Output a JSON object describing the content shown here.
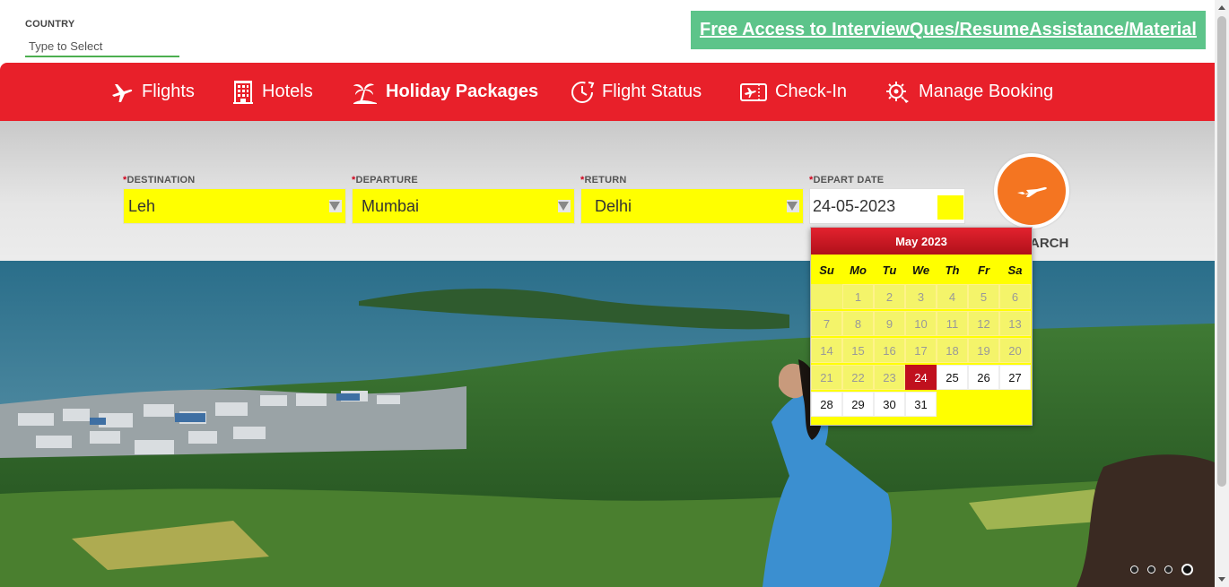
{
  "country": {
    "label": "COUNTRY",
    "placeholder": "Type to Select"
  },
  "promo": {
    "text": "Free Access to InterviewQues/ResumeAssistance/Material"
  },
  "nav": {
    "flights": "Flights",
    "hotels": "Hotels",
    "holiday": "Holiday Packages",
    "status": "Flight Status",
    "checkin": "Check-In",
    "manage": "Manage Booking"
  },
  "form": {
    "destination_label": "DESTINATION",
    "destination_value": "Leh",
    "departure_label": "DEPARTURE",
    "departure_value": "Mumbai",
    "return_label": "RETURN",
    "return_value": "Delhi",
    "depart_date_label": "DEPART DATE",
    "depart_date_value": "24-05-2023",
    "required_mark": "*"
  },
  "search": {
    "label": "ARCH"
  },
  "calendar": {
    "title": "May 2023",
    "days_of_week": [
      "Su",
      "Mo",
      "Tu",
      "We",
      "Th",
      "Fr",
      "Sa"
    ],
    "weeks": [
      [
        null,
        "1",
        "2",
        "3",
        "4",
        "5",
        "6"
      ],
      [
        "7",
        "8",
        "9",
        "10",
        "11",
        "12",
        "13"
      ],
      [
        "14",
        "15",
        "16",
        "17",
        "18",
        "19",
        "20"
      ],
      [
        "21",
        "22",
        "23",
        "24",
        "25",
        "26",
        "27"
      ],
      [
        "28",
        "29",
        "30",
        "31",
        null,
        null,
        null
      ]
    ],
    "selected_day": "24"
  },
  "colors": {
    "nav_red": "#e8202a",
    "field_yellow": "#ffff00",
    "promo_green": "#5dc48a",
    "search_orange": "#f47521",
    "selected_red": "#c0101e"
  },
  "slider": {
    "count": 4,
    "active_index": 3
  }
}
